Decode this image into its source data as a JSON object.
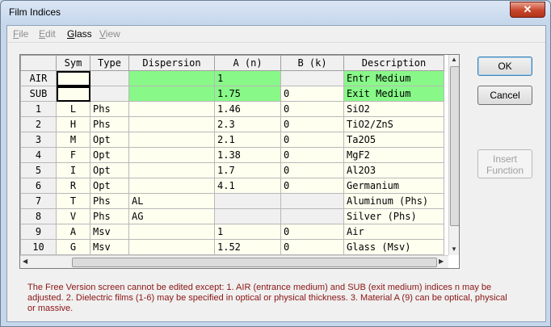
{
  "window": {
    "title": "Film Indices",
    "close_glyph": "✕"
  },
  "menu": [
    {
      "label": "File",
      "enabled": false
    },
    {
      "label": "Edit",
      "enabled": false
    },
    {
      "label": "Glass",
      "enabled": true
    },
    {
      "label": "View",
      "enabled": false
    }
  ],
  "table": {
    "columns": [
      "",
      "Sym",
      "Type",
      "Dispersion",
      "A (n)",
      "B (k)",
      "Description"
    ],
    "rows": [
      [
        "AIR",
        "",
        "",
        "",
        "1",
        "",
        "Entr Medium"
      ],
      [
        "SUB",
        "",
        "",
        "",
        "1.75",
        "0",
        "Exit Medium"
      ],
      [
        "1",
        "L",
        "Phs",
        "",
        "1.46",
        "0",
        "SiO2"
      ],
      [
        "2",
        "H",
        "Phs",
        "",
        "2.3",
        "0",
        "TiO2/ZnS"
      ],
      [
        "3",
        "M",
        "Opt",
        "",
        "2.1",
        "0",
        "Ta2O5"
      ],
      [
        "4",
        "F",
        "Opt",
        "",
        "1.38",
        "0",
        "MgF2"
      ],
      [
        "5",
        "I",
        "Opt",
        "",
        "1.7",
        "0",
        "Al2O3"
      ],
      [
        "6",
        "R",
        "Opt",
        "",
        "4.1",
        "0",
        "Germanium"
      ],
      [
        "7",
        "T",
        "Phs",
        "AL",
        "",
        "",
        "Aluminum (Phs)"
      ],
      [
        "8",
        "V",
        "Phs",
        "AG",
        "",
        "",
        "Silver (Phs)"
      ],
      [
        "9",
        "A",
        "Msv",
        "",
        "1",
        "0",
        "Air"
      ],
      [
        "10",
        "G",
        "Msv",
        "",
        "1.52",
        "0",
        "Glass (Msv)"
      ]
    ]
  },
  "buttons": {
    "ok": "OK",
    "cancel": "Cancel",
    "insert_line1": "Insert",
    "insert_line2": "Function"
  },
  "note": "The Free Version screen cannot be edited except: 1. AIR (entrance medium) and SUB (exit medium) indices n may be adjusted. 2. Dielectric films (1-6) may be specified in optical or physical thickness. 3. Material A (9) can be optical, physical or massive.",
  "colors": {
    "highlight_green": "#88f888",
    "cell_bg": "#fffff0",
    "note_text": "#8b1414"
  }
}
